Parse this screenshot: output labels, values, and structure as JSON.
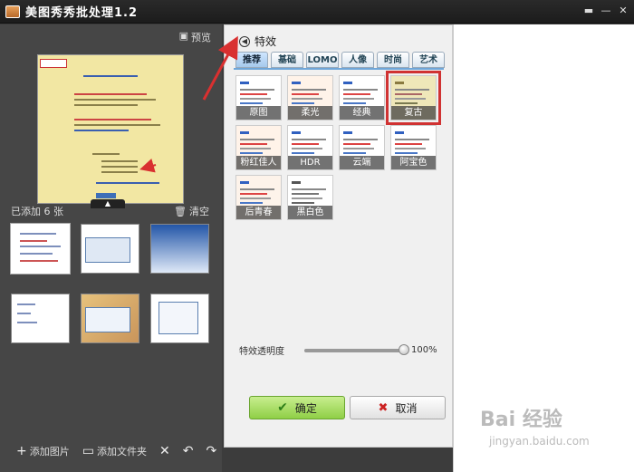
{
  "window": {
    "title": "美图秀秀批处理1.2",
    "controls": [
      "▬",
      "—",
      "✕"
    ]
  },
  "left": {
    "preview_label": "预览",
    "added_label": "已添加 6 张",
    "clear_label": "清空",
    "bottom": {
      "add_image": "添加图片",
      "add_folder": "添加文件夹"
    }
  },
  "effects": {
    "header": "特效",
    "tabs": [
      "推荐",
      "基础",
      "LOMO",
      "人像",
      "时尚",
      "艺术"
    ],
    "active_tab": 0,
    "items": [
      {
        "label": "原图"
      },
      {
        "label": "柔光"
      },
      {
        "label": "经典LOMO"
      },
      {
        "label": "复古"
      },
      {
        "label": "粉红佳人"
      },
      {
        "label": "HDR"
      },
      {
        "label": "云端"
      },
      {
        "label": "阿宝色"
      },
      {
        "label": "后青春"
      },
      {
        "label": "黑白色"
      }
    ],
    "selected_item": "复古",
    "opacity_label": "特效透明度",
    "opacity_value": "100%",
    "opacity_fraction": 1.0,
    "confirm_label": "确定",
    "cancel_label": "取消"
  },
  "watermark": {
    "brand": "Bai 经验",
    "url": "jingyan.baidu.com"
  },
  "colors": {
    "accent_red": "#d03232",
    "confirm_green": "#8fcf46",
    "tab_blue": "#6ea6d9"
  }
}
